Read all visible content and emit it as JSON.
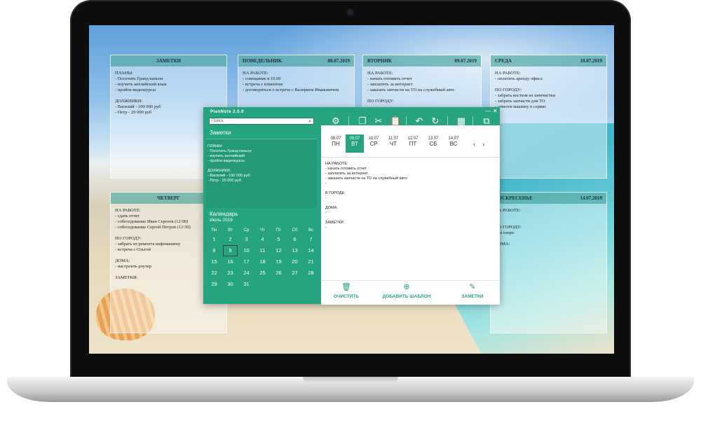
{
  "app": {
    "title": "PlanNote 2.0.0",
    "search_placeholder": "Поиск",
    "close_symbol": "✕",
    "minimize_symbol": "—",
    "accent_color": "#26a37f",
    "toolbar_icons": [
      "settings-icon",
      "copy-icon",
      "cut-icon",
      "paste-icon",
      "undo-icon",
      "redo-icon",
      "calendar-today-icon",
      "export-icon"
    ]
  },
  "notes": {
    "title": "Заметки",
    "text": "ПЛАНЫ:\n- Посетить Гранд каньон\n- изучить английский\n- пройти видеокурсы\n\nДОЛЖНИКИ:\n- Василий - 100 000 руб.\n- Петр - 20 000 руб."
  },
  "calendar": {
    "title": "Календарь",
    "month": "Июль 2019",
    "weekdays": [
      "Пн",
      "Вт",
      "Ср",
      "Чт",
      "Пт",
      "Сб",
      "Вс"
    ],
    "weeks": [
      [
        "1",
        "2",
        "3",
        "4",
        "5",
        "6",
        "7"
      ],
      [
        "8",
        "9",
        "10",
        "11",
        "12",
        "13",
        "14"
      ],
      [
        "15",
        "16",
        "17",
        "18",
        "19",
        "20",
        "21"
      ],
      [
        "22",
        "23",
        "24",
        "25",
        "26",
        "27",
        "28"
      ],
      [
        "29",
        "30",
        "31",
        "",
        "",
        "",
        ""
      ]
    ],
    "selected_day": "9"
  },
  "week": {
    "days": [
      {
        "date": "08.07",
        "wd": "ПН"
      },
      {
        "date": "09.07",
        "wd": "ВТ"
      },
      {
        "date": "10.07",
        "wd": "СР"
      },
      {
        "date": "11.07",
        "wd": "ЧТ"
      },
      {
        "date": "12.07",
        "wd": "ПТ"
      },
      {
        "date": "13.07",
        "wd": "СБ"
      },
      {
        "date": "14.07",
        "wd": "ВС"
      }
    ],
    "active_index": 1,
    "prev_symbol": "‹",
    "next_symbol": "›"
  },
  "day_content": "НА РАБОТЕ:\n- начать готовить отчет\n- заплатить за интернет\n- заказать запчасти на ТО на служебный авто\n-\n\nВ ГОРОДЕ:\n-\n\nДОМА:\n-\n\nЗАМЕТКИ:\n-",
  "bottom_buttons": [
    {
      "icon": "trash-icon",
      "label": "ОЧИСТИТЬ"
    },
    {
      "icon": "plus-circle-icon",
      "label": "ДОБАВИТЬ ШАБЛОН"
    },
    {
      "icon": "pencil-icon",
      "label": "ЗАМЕТКИ"
    }
  ],
  "background_cards": [
    {
      "title": "ЗАМЕТКИ",
      "date": "",
      "text": "ПЛАНЫ:\n- Посетить Гранд каньон\n- изучить английский язык\n- пройти видеокурсы\n\nДОЛЖНИКИ:\n- Василий - 100 000 руб\n- Петр - 20 000 руб"
    },
    {
      "title": "ПОНЕДЕЛЬНИК",
      "date": "08.07.2019",
      "text": "НА РАБОТЕ:\n- совещание в 10.00\n- встреча с клиентом\n- договориться о встрече с Валерием Ивановичем"
    },
    {
      "title": "ВТОРНИК",
      "date": "09.07.2019",
      "text": "НА РАБОТЕ:\n- начать готовить отчет\n- заплатить за интернет\n- заказать запчасти на ТО на служебный авто\n\nПО ГОРОДУ:"
    },
    {
      "title": "СРЕДА",
      "date": "10.07.2019",
      "text": "НА РАБОТЕ:\n- оплатить аренду офиса\n\nПО ГОРОДУ:\n- забрать костюм из химчистки\n- забрать запчасти для ТО\n- отвезти машину в сервис"
    },
    {
      "title": "ЧЕТВЕРГ",
      "date": "",
      "text": "НА РАБОТЕ:\n- сдать отчет\n- собеседование Иван Сергеев (12:00)\n- собеседование Сергей Петров (12:30)\n\nПО ГОРОДУ:\n- забрать из ремонта кофемашину\n- встреча с Ольгой\n\nДОМА:\n- настроить роутер\n\nЗАМЕТКИ:"
    },
    {
      "title": "ВОСКРЕСЕНЬЕ",
      "date": "14.07.2019",
      "text": "НА РАБОТЕ:\n-\n\nПО ГОРОДУ:\n- на озеро\n\nДОМА:"
    }
  ]
}
